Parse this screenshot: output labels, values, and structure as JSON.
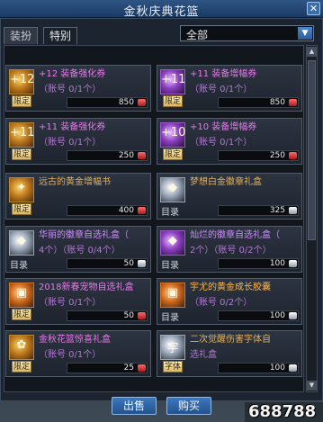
{
  "window": {
    "title": "金秋庆典花篮",
    "close_icon": "✕"
  },
  "tabs": [
    {
      "label": "装扮"
    },
    {
      "label": "特别"
    }
  ],
  "filter": {
    "selected": "全部"
  },
  "items": [
    {
      "icon": "gold",
      "icon_glyph": "+12",
      "tag": "限定",
      "name": "+12 装备强化券",
      "sub": "（账号 0/1个）",
      "price": "850",
      "coin": "red",
      "name_color": "pink"
    },
    {
      "icon": "purple",
      "icon_glyph": "+11",
      "tag": "限定",
      "name": "+11 装备增幅券",
      "sub": "（账号 0/1个）",
      "price": "850",
      "coin": "red",
      "name_color": "pink"
    },
    {
      "icon": "gold",
      "icon_glyph": "+11",
      "tag": "限定",
      "name": "+11 装备强化券",
      "sub": "（账号 0/1个）",
      "price": "250",
      "coin": "red",
      "name_color": "pink"
    },
    {
      "icon": "purple",
      "icon_glyph": "+10",
      "tag": "限定",
      "name": "+10 装备增幅券",
      "sub": "（账号 0/1个）",
      "price": "250",
      "coin": "red",
      "name_color": "pink"
    },
    {
      "icon": "gold",
      "icon_glyph": "✦",
      "tag": "限定",
      "name": "远古的黄金增幅书",
      "sub": "",
      "price": "400",
      "coin": "red",
      "name_color": "gold"
    },
    {
      "icon": "white",
      "icon_glyph": "◆",
      "tag": "目录",
      "name": "梦想白金徽章礼盒",
      "sub": "",
      "price": "325",
      "coin": "silver",
      "name_color": "gold"
    },
    {
      "icon": "white",
      "icon_glyph": "◆",
      "tag": "目录",
      "name": "华丽的徽章自选礼盒（",
      "sub": "4个）（账号 0/4个）",
      "price": "50",
      "coin": "silver",
      "name_color": "purple"
    },
    {
      "icon": "purple",
      "icon_glyph": "◆",
      "tag": "目录",
      "name": "灿烂的徽章自选礼盒（",
      "sub": "2个）（账号 0/2个）",
      "price": "100",
      "coin": "silver",
      "name_color": "purple"
    },
    {
      "icon": "orange",
      "icon_glyph": "▣",
      "tag": "限定",
      "name": "2018新春宠物自选礼盒",
      "sub": "（账号 0/1个）",
      "price": "50",
      "coin": "red",
      "name_color": "pink"
    },
    {
      "icon": "orange",
      "icon_glyph": "▣",
      "tag": "目录",
      "name": "宇尤的黄金成长胶囊",
      "sub": "（账号 0/2个）",
      "price": "100",
      "coin": "silver",
      "name_color": "orange"
    },
    {
      "icon": "gold",
      "icon_glyph": "✿",
      "tag": "限定",
      "name": "金秋花篮惊喜礼盒",
      "sub": "（账号 0/1个）",
      "price": "25",
      "coin": "red",
      "name_color": "pink"
    },
    {
      "icon": "white",
      "icon_glyph": "字",
      "tag": "字体",
      "name": "二次觉醒伤害字体自",
      "sub": "选礼盒",
      "price": "100",
      "coin": "silver",
      "name_color": "gold"
    }
  ],
  "buttons": {
    "sell": "出售",
    "buy": "购买"
  },
  "gold_amount": "688788",
  "colors": {
    "accent": "#2f5585",
    "price_red": "#d02a2a"
  }
}
